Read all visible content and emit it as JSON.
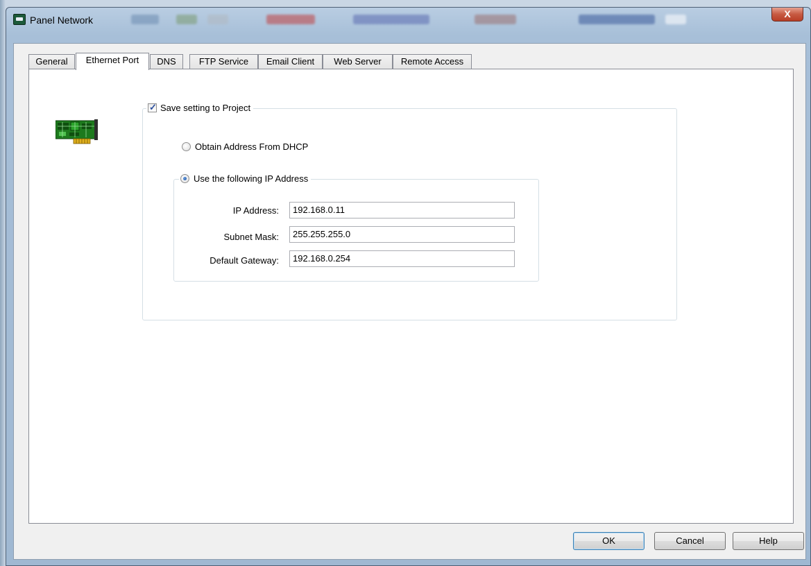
{
  "window": {
    "title": "Panel Network",
    "close_label": "X"
  },
  "tabs": [
    {
      "label": "General"
    },
    {
      "label": "Ethernet Port",
      "active": true
    },
    {
      "label": "DNS"
    },
    {
      "label": "FTP Service"
    },
    {
      "label": "Email Client"
    },
    {
      "label": "Web Server"
    },
    {
      "label": "Remote Access"
    }
  ],
  "ethernet": {
    "save_to_project_label": "Save setting to Project",
    "save_to_project_checked": true,
    "dhcp_label": "Obtain Address From DHCP",
    "dhcp_selected": false,
    "static_label": "Use the following IP Address",
    "static_selected": true,
    "ip_label": "IP Address:",
    "ip_value": "192.168.0.11",
    "subnet_label": "Subnet Mask:",
    "subnet_value": "255.255.255.0",
    "gateway_label": "Default Gateway:",
    "gateway_value": "192.168.0.254"
  },
  "buttons": {
    "ok": "OK",
    "cancel": "Cancel",
    "help": "Help"
  },
  "icons": {
    "app": "panel-app-icon",
    "nic": "network-card-icon",
    "close": "close-icon"
  }
}
